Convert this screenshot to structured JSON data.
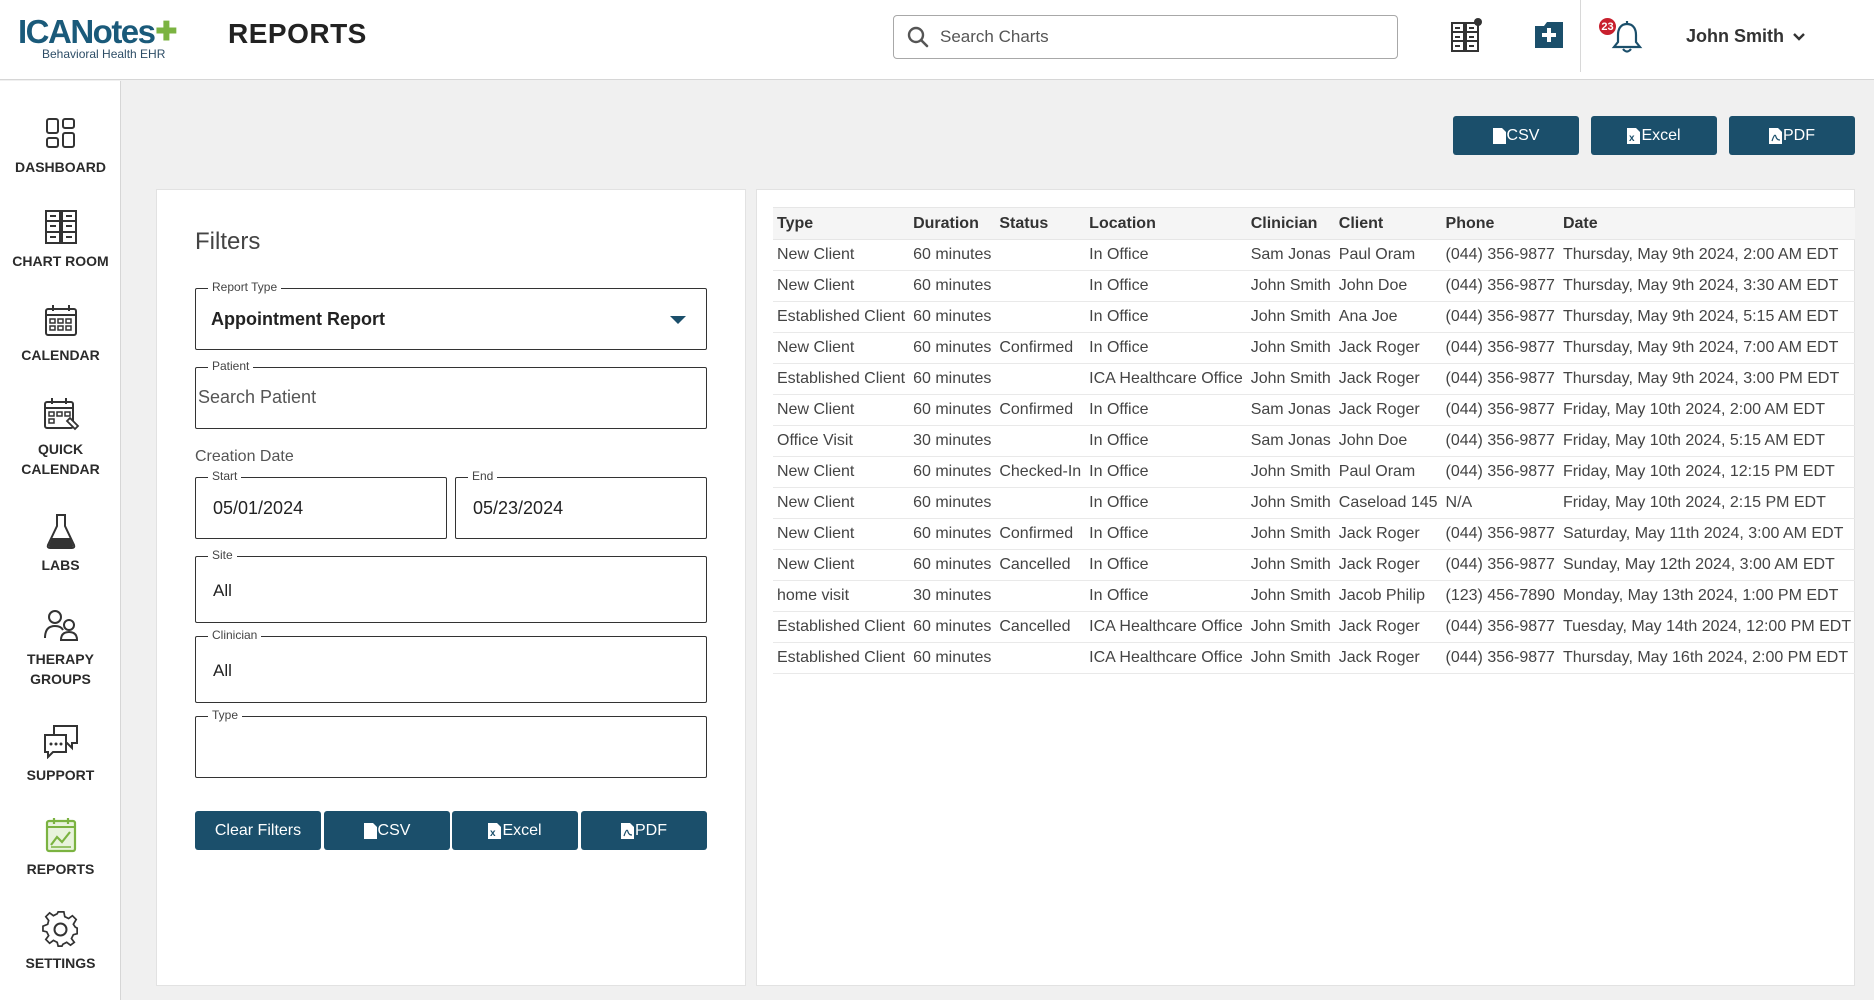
{
  "app": {
    "logo_text": "ICANotes",
    "logo_subtitle": "Behavioral Health EHR",
    "page_title": "REPORTS"
  },
  "header": {
    "search_placeholder": "Search Charts",
    "notification_count": "23",
    "user_name": "John Smith",
    "icons": [
      "chart-room-alert-icon",
      "add-chart-icon",
      "bell-icon",
      "chevron-down-icon"
    ]
  },
  "sidebar": {
    "items": [
      {
        "label": "DASHBOARD",
        "icon": "dashboard-icon"
      },
      {
        "label": "CHART ROOM",
        "icon": "chart-room-icon"
      },
      {
        "label": "CALENDAR",
        "icon": "calendar-icon"
      },
      {
        "label": "QUICK\nCALENDAR",
        "icon": "quick-calendar-icon"
      },
      {
        "label": "LABS",
        "icon": "flask-icon"
      },
      {
        "label": "THERAPY\nGROUPS",
        "icon": "group-icon"
      },
      {
        "label": "SUPPORT",
        "icon": "chat-icon"
      },
      {
        "label": "REPORTS",
        "icon": "reports-icon",
        "active": true
      },
      {
        "label": "SETTINGS",
        "icon": "gear-icon"
      }
    ],
    "active_color": "#7bb341"
  },
  "export_buttons": {
    "csv": "CSV",
    "excel": "Excel",
    "pdf": "PDF"
  },
  "filters": {
    "title": "Filters",
    "report_type_label": "Report Type",
    "report_type_value": "Appointment Report",
    "patient_label": "Patient",
    "patient_placeholder": "Search Patient",
    "creation_date_label": "Creation Date",
    "start_label": "Start",
    "start_value": "05/01/2024",
    "end_label": "End",
    "end_value": "05/23/2024",
    "site_label": "Site",
    "site_value": "All",
    "clinician_label": "Clinician",
    "clinician_value": "All",
    "type_label": "Type",
    "type_value": "",
    "clear_label": "Clear Filters"
  },
  "table": {
    "columns": [
      "Type",
      "Duration",
      "Status",
      "Location",
      "Clinician",
      "Client",
      "Phone",
      "Date"
    ],
    "rows": [
      [
        "New Client",
        "60 minutes",
        "",
        "In Office",
        "Sam Jonas",
        "Paul Oram",
        "(044) 356-9877",
        "Thursday, May 9th 2024, 2:00 AM EDT"
      ],
      [
        "New Client",
        "60 minutes",
        "",
        "In Office",
        "John Smith",
        "John Doe",
        "(044) 356-9877",
        "Thursday, May 9th 2024, 3:30 AM EDT"
      ],
      [
        "Established Client",
        "60 minutes",
        "",
        "In Office",
        "John Smith",
        "Ana Joe",
        "(044) 356-9877",
        "Thursday, May 9th 2024, 5:15 AM EDT"
      ],
      [
        "New Client",
        "60 minutes",
        "Confirmed",
        "In Office",
        "John Smith",
        "Jack Roger",
        "(044) 356-9877",
        "Thursday, May 9th 2024, 7:00 AM EDT"
      ],
      [
        "Established Client",
        "60 minutes",
        "",
        "ICA Healthcare Office",
        "John Smith",
        "Jack Roger",
        "(044) 356-9877",
        "Thursday, May 9th 2024, 3:00 PM EDT"
      ],
      [
        "New Client",
        "60 minutes",
        "Confirmed",
        "In Office",
        "Sam Jonas",
        "Jack Roger",
        "(044) 356-9877",
        "Friday, May 10th 2024, 2:00 AM EDT"
      ],
      [
        "Office Visit",
        "30 minutes",
        "",
        "In Office",
        "Sam Jonas",
        "John Doe",
        "(044) 356-9877",
        "Friday, May 10th 2024, 5:15 AM EDT"
      ],
      [
        "New Client",
        "60 minutes",
        "Checked-In",
        "In Office",
        "John Smith",
        "Paul Oram",
        "(044) 356-9877",
        "Friday, May 10th 2024, 12:15 PM EDT"
      ],
      [
        "New Client",
        "60 minutes",
        "",
        "In Office",
        "John Smith",
        "Caseload 145",
        "N/A",
        "Friday, May 10th 2024, 2:15 PM EDT"
      ],
      [
        "New Client",
        "60 minutes",
        "Confirmed",
        "In Office",
        "John Smith",
        "Jack Roger",
        "(044) 356-9877",
        "Saturday, May 11th 2024, 3:00 AM EDT"
      ],
      [
        "New Client",
        "60 minutes",
        "Cancelled",
        "In Office",
        "John Smith",
        "Jack Roger",
        "(044) 356-9877",
        "Sunday, May 12th 2024, 3:00 AM EDT"
      ],
      [
        "home visit",
        "30 minutes",
        "",
        "In Office",
        "John Smith",
        "Jacob Philip",
        "(123) 456-7890",
        "Monday, May 13th 2024, 1:00 PM EDT"
      ],
      [
        "Established Client",
        "60 minutes",
        "Cancelled",
        "ICA Healthcare Office",
        "John Smith",
        "Jack Roger",
        "(044) 356-9877",
        "Tuesday, May 14th 2024, 12:00 PM EDT"
      ],
      [
        "Established Client",
        "60 minutes",
        "",
        "ICA Healthcare Office",
        "John Smith",
        "Jack Roger",
        "(044) 356-9877",
        "Thursday, May 16th 2024, 2:00 PM EDT"
      ]
    ]
  },
  "colors": {
    "primary_button": "#1b4f6b",
    "brand_blue": "#1a5a7a",
    "badge_red": "#c8202e"
  }
}
